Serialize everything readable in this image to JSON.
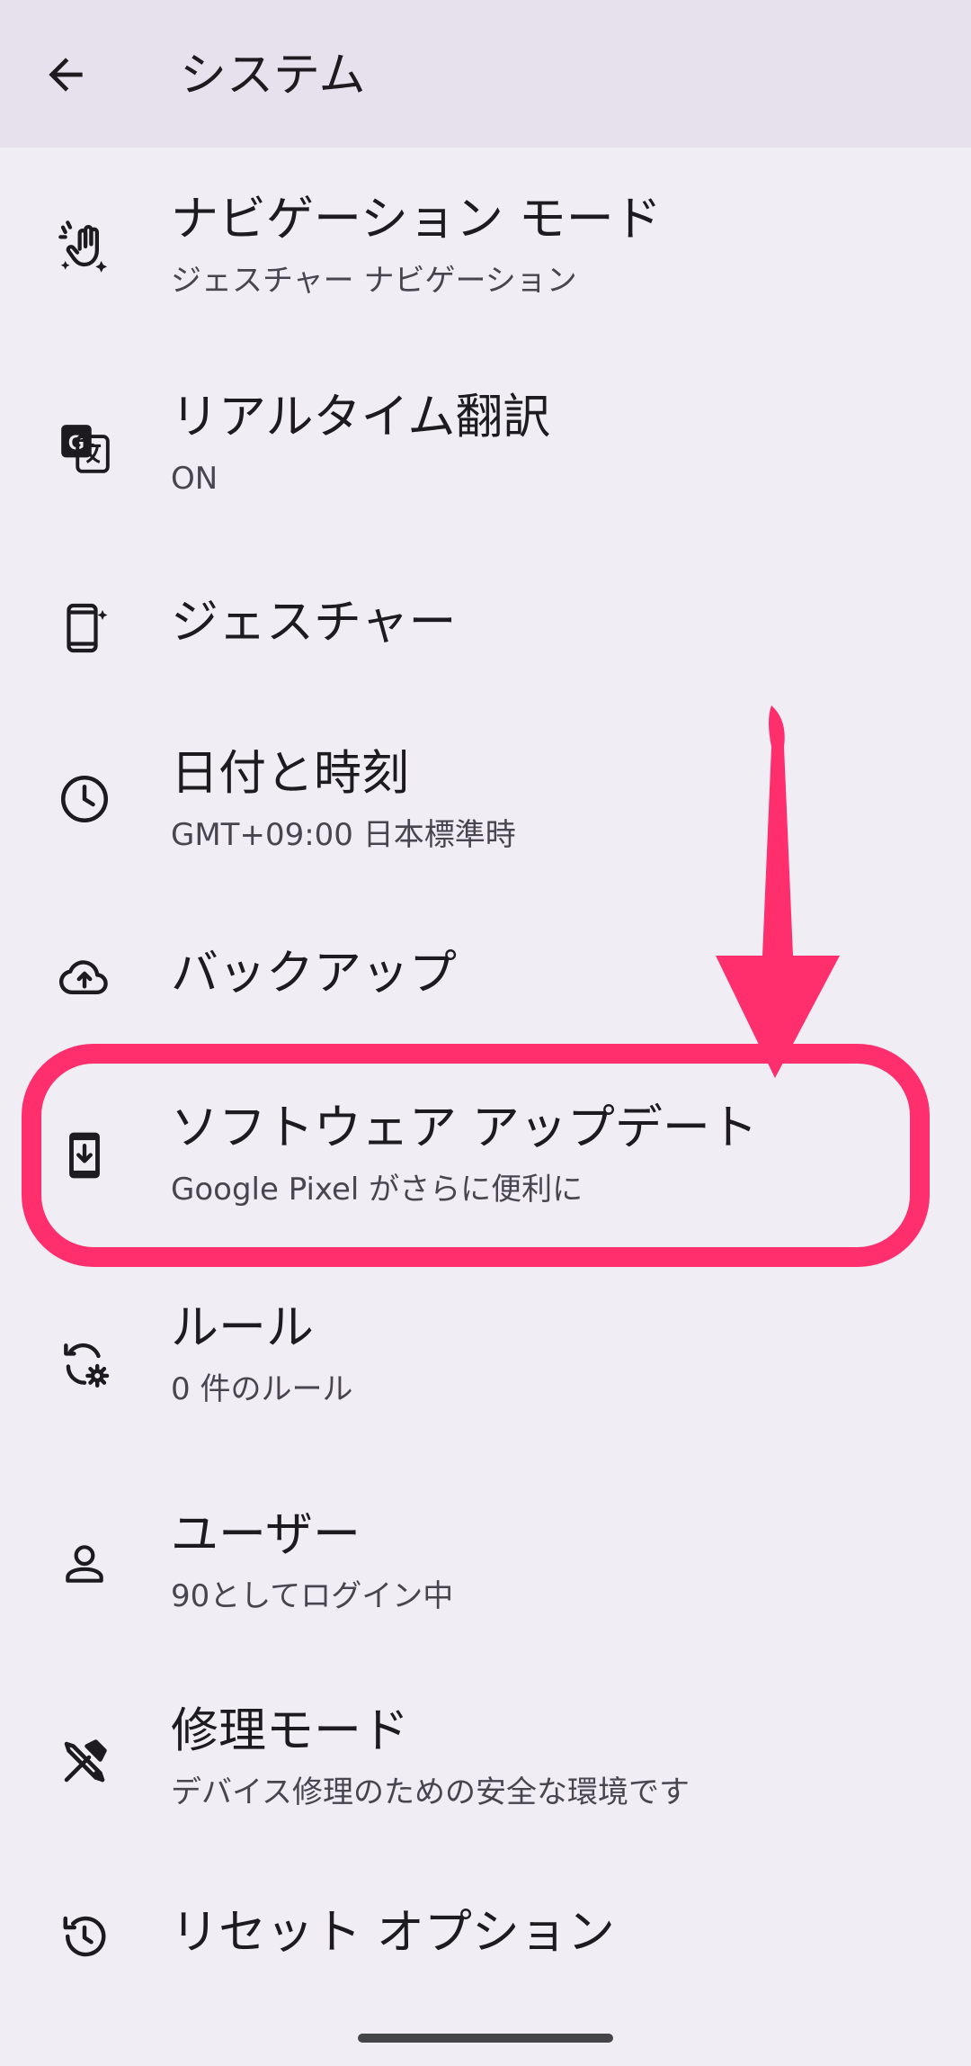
{
  "app_bar": {
    "title": "システム",
    "back_icon": "arrow-back-icon"
  },
  "items": [
    {
      "title": "ナビゲーション モード",
      "subtitle": "ジェスチャー ナビゲーション",
      "icon": "gesture-hand-icon"
    },
    {
      "title": "リアルタイム翻訳",
      "subtitle": "ON",
      "icon": "translate-icon"
    },
    {
      "title": "ジェスチャー",
      "subtitle": "",
      "icon": "phone-sparkle-icon"
    },
    {
      "title": "日付と時刻",
      "subtitle": "GMT+09:00 日本標準時",
      "icon": "clock-icon"
    },
    {
      "title": "バックアップ",
      "subtitle": "",
      "icon": "cloud-upload-icon"
    },
    {
      "title": "ソフトウェア アップデート",
      "subtitle": "Google Pixel がさらに便利に",
      "icon": "system-update-icon"
    },
    {
      "title": "ルール",
      "subtitle": "0 件のルール",
      "icon": "rules-sync-gear-icon"
    },
    {
      "title": "ユーザー",
      "subtitle": "90としてログイン中",
      "icon": "person-icon"
    },
    {
      "title": "修理モード",
      "subtitle": "デバイス修理のための安全な環境です",
      "icon": "repair-tools-icon"
    },
    {
      "title": "リセット オプション",
      "subtitle": "",
      "icon": "history-reset-icon"
    }
  ],
  "annotation": {
    "color": "#ff2f6d",
    "highlighted_item": "ソフトウェア アップデート"
  },
  "colors": {
    "background": "#f1edf4",
    "app_bar": "#e6e1ec",
    "text_primary": "#1d1b20",
    "text_secondary": "#49454f"
  }
}
